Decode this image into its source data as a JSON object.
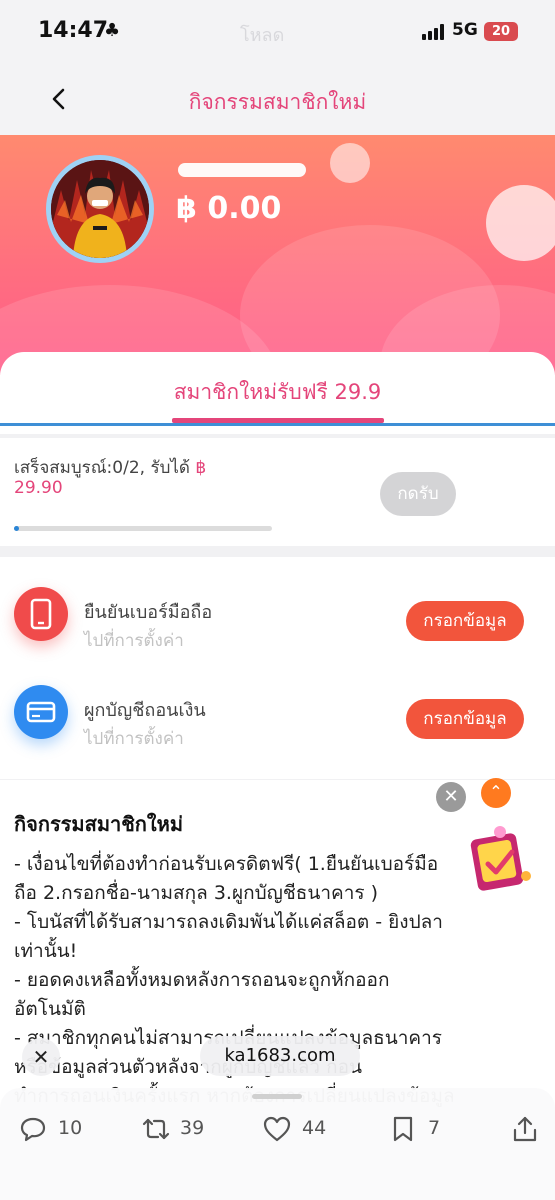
{
  "status_bar": {
    "time": "14:47",
    "center_text": "โหลด",
    "network": "5G",
    "battery": "20"
  },
  "header": {
    "title": "กิจกรรมสมาชิกใหม่"
  },
  "account": {
    "balance": "฿ 0.00"
  },
  "tab": {
    "label": "สมาชิกใหม่รับฟรี 29.9"
  },
  "progress": {
    "prefix": "เสร็จสมบูรณ์:0/2, รับได้ ",
    "currency": "฿",
    "amount": "29.90",
    "claim_label": "กดรับ",
    "fraction": 0.02
  },
  "tasks": [
    {
      "title": "ยืนยันเบอร์มือถือ",
      "subtitle": "ไปที่การตั้งค่า",
      "button": "กรอกข้อมูล",
      "icon": "phone-icon"
    },
    {
      "title": "ผูกบัญชีถอนเงิน",
      "subtitle": "ไปที่การตั้งค่า",
      "button": "กรอกข้อมูล",
      "icon": "card-icon"
    }
  ],
  "description": {
    "title": "กิจกรรมสมาชิกใหม่",
    "lines": [
      "- เงื่อนไขที่ต้องทำก่อนรับเครดิตฟรี( 1.ยืนยันเบอร์มือ",
      "ถือ  2.กรอกชื่อ-นามสกุล  3.ผูกบัญชีธนาคาร )",
      "- โบนัสที่ได้รับสามารถลงเดิมพันได้แค่สล็อต - ยิงปลา",
      "เท่านั้น!",
      "- ยอดคงเหลือทั้งหมดหลังการถอนจะถูกหักออก",
      "อัตโนมัติ",
      "- สมาชิกทุกคนไม่สามารถเปลี่ยนแปลงข้อมูลธนาคาร",
      "หรือข้อมูลส่วนตัวหลังจากผูกบัญชีแล้ว ก่อน",
      "ทำการถอนเงินครั้งแรก หากต้องการเปลี่ยนแปลงข้อมูล"
    ]
  },
  "browser": {
    "url": "ka1683.com"
  },
  "actions": {
    "replies": "10",
    "reposts": "39",
    "likes": "44",
    "bookmarks": "7"
  },
  "colors": {
    "accent": "#e4457a",
    "button_orange": "#f2553c",
    "banner_top": "#ff8a6f",
    "banner_bottom": "#ff5c8a",
    "progress_blue": "#2a85d6"
  }
}
